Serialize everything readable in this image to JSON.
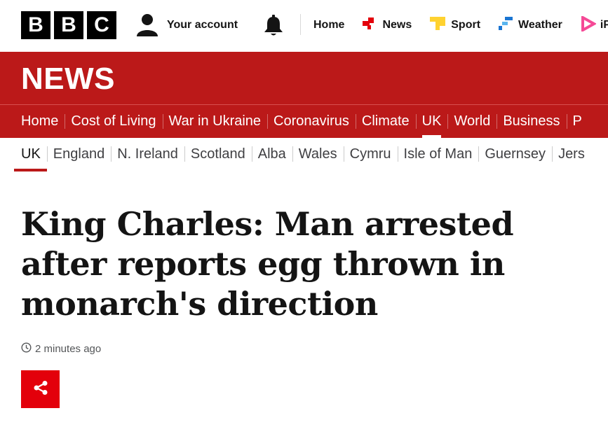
{
  "masthead": {
    "logo_letters": [
      "B",
      "B",
      "C"
    ],
    "account_label": "Your account",
    "nav": [
      {
        "label": "Home",
        "icon": "none"
      },
      {
        "label": "News",
        "icon": "news-icon",
        "color": "#e3000b"
      },
      {
        "label": "Sport",
        "icon": "sport-icon",
        "color": "#ffd230"
      },
      {
        "label": "Weather",
        "icon": "weather-icon",
        "color": "#1a75d2"
      },
      {
        "label": "iP",
        "icon": "iplayer-icon",
        "color": "#f54996"
      }
    ]
  },
  "brand": {
    "title": "NEWS",
    "color": "#bb1919"
  },
  "section_nav": {
    "items": [
      "Home",
      "Cost of Living",
      "War in Ukraine",
      "Coronavirus",
      "Climate",
      "UK",
      "World",
      "Business",
      "P"
    ],
    "active": "UK"
  },
  "sub_nav": {
    "items": [
      "UK",
      "England",
      "N. Ireland",
      "Scotland",
      "Alba",
      "Wales",
      "Cymru",
      "Isle of Man",
      "Guernsey",
      "Jers"
    ],
    "active": "UK"
  },
  "article": {
    "headline": "King Charles: Man arrested after reports egg thrown in monarch's direction",
    "timestamp": "2 minutes ago",
    "share_icon": "share-icon",
    "share_color": "#e3000b"
  }
}
